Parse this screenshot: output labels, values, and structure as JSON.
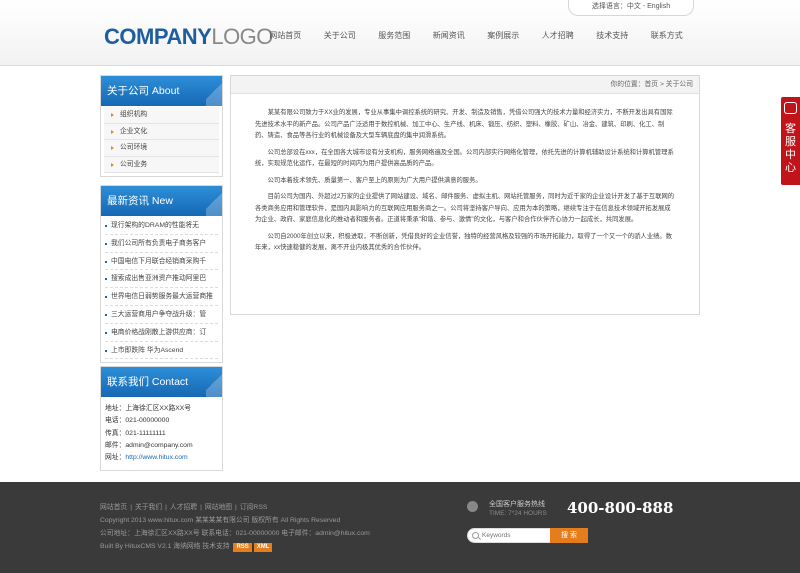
{
  "header": {
    "lang_label": "选择语言：中文 - English",
    "logo_bold": "COMPANY",
    "logo_light": "LOGO",
    "nav": [
      "网站首页",
      "关于公司",
      "服务范围",
      "新闻资讯",
      "案例展示",
      "人才招聘",
      "技术支持",
      "联系方式"
    ]
  },
  "sidebar": {
    "about": {
      "title": "关于公司  About",
      "items": [
        "组织机构",
        "企业文化",
        "公司环境",
        "公司业务"
      ]
    },
    "news": {
      "title": "最新资讯  New",
      "items": [
        "现行架构的DRAM的性能将无",
        "我们公司所有负责电子商务客户",
        "中国电信下月联合经销商采购千",
        "搜索成出售亚洲资产推动阿里巴",
        "世界电信日弱势服务最大运营商推",
        "三大运营商用户争夺战升级：管",
        "电商价格战刚散上游供应商：订",
        "上市即跌阵 华为Ascend"
      ]
    },
    "contact": {
      "title": "联系我们  Contact",
      "address": "地址：上海徐汇区XX路XX号",
      "phone": "电话：021-00000000",
      "fax": "传真：021-11111111",
      "email": "邮件：admin@company.com",
      "website_label": "网址：",
      "website": "http://www.hitux.com"
    }
  },
  "main": {
    "breadcrumb": "你的位置：首页 > 关于公司",
    "paragraphs": [
      "某某有限公司致力于XX业的发展，专业从事集中调控系统的研究、开发、制造及销售，凭借公司强大的技术力量和经济实力，不断开发出具有国际先进技术水平的新产品。公司产品广泛适用于数控机械、加工中心、生产线、机床、锻压、纺织、塑料、橡胶、矿山、冶金、建筑、印刷、化工、制药、铸造、食品等各行业的机械设备及大型车辆底盘的集中润滑系统。",
      "公司总部设在xxx，在全国各大城市设有分支机构，服务网络遍及全国。公司内部实行网络化管理，依托先进的计算机辅助设计系统和计算机管理系统，实现规范化运作，在最短的时间内为用户提供高品质的产品。",
      "公司本着技术领先、质量第一、客户至上的原则为广大用户提供满意的服务。",
      "目前公司为国内、外超过2万家的企业提供了网站建设、域名、邮件服务、虚拟主机、网站托管服务，同时为近千家的企业设计开发了基于互联网的各类商务应用和管理软件，是国内具影响力的互联网应用服务商之一。公司将坚持客户导向、应用为本的策略，继续专注于在信息技术领域开拓发展成为企业、政府、家庭信息化的推动者和服务者。正道将秉承\"和谐、参与、激情\"的文化，与客户和合作伙伴齐心协力一起成长，共同发展。",
      "公司自2000年创立以来，积极进取，不断创新，凭借良好的企业信誉，独特的经营风格及较强的市场开拓能力，取得了一个又一个的骄人业绩。数年来，xx快速稳健的发展，离不开业内极其优秀的合作伙伴。"
    ]
  },
  "service_tab": "客服中心",
  "footer": {
    "links": [
      "网站首页",
      "关于我们",
      "人才招聘",
      "网站地图",
      "订阅RSS"
    ],
    "copyright": "Copyright 2013 www.hitux.com 某某某某有限公司 版权所有 All Rights Reserved",
    "address": "公司地址：上海徐汇区XX路XX号 联系电话：021-00000000 电子邮件：admin@hitux.com",
    "built": "Built By HituxCMS V2.1 海纳网络 技术支持",
    "tag_rss": "RSS",
    "tag_xml": "XML",
    "hotline_label": "全国客户服务热线",
    "hotline_hours": "TIME: 7*24 HOURS",
    "hotline_number": "400-800-888",
    "search_placeholder": "Keywords",
    "search_button": "搜  索"
  }
}
